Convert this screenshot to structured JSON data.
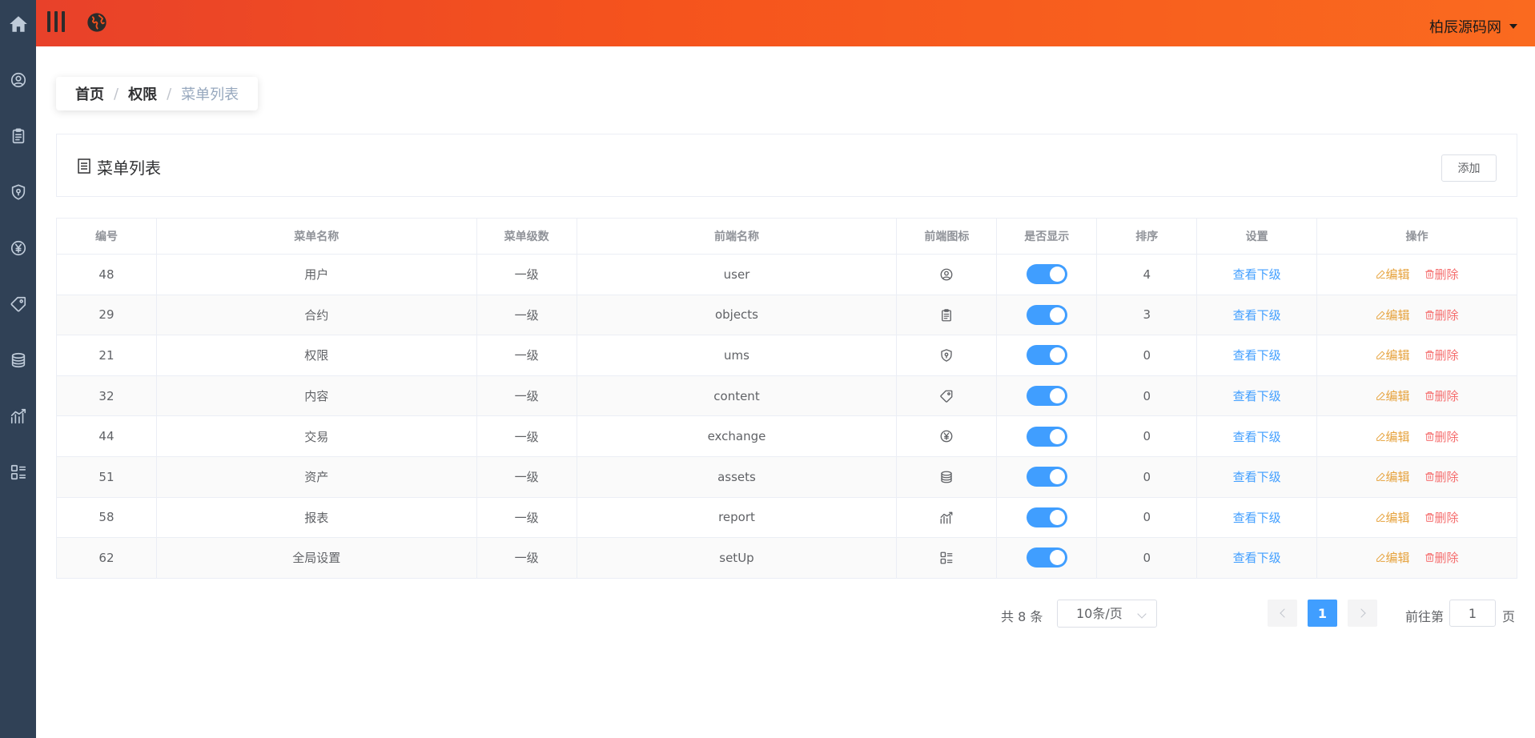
{
  "header": {
    "user_name": "柏辰源码网"
  },
  "sidebar": {
    "items": [
      {
        "icon": "home-icon"
      },
      {
        "icon": "user-icon"
      },
      {
        "icon": "clipboard-icon"
      },
      {
        "icon": "shield-icon"
      },
      {
        "icon": "yen-icon"
      },
      {
        "icon": "tag-icon"
      },
      {
        "icon": "coins-icon"
      },
      {
        "icon": "chart-icon"
      },
      {
        "icon": "list-grid-icon"
      }
    ]
  },
  "breadcrumb": {
    "home": "首页",
    "section": "权限",
    "separator": "/",
    "current": "菜单列表"
  },
  "panel": {
    "title": "菜单列表",
    "add_label": "添加"
  },
  "table": {
    "columns": [
      "编号",
      "菜单名称",
      "菜单级数",
      "前端名称",
      "前端图标",
      "是否显示",
      "排序",
      "设置",
      "操作"
    ],
    "rows": [
      {
        "id": "48",
        "name": "用户",
        "level": "一级",
        "frontend": "user",
        "icon": "user-icon",
        "shown": true,
        "sort": "4"
      },
      {
        "id": "29",
        "name": "合约",
        "level": "一级",
        "frontend": "objects",
        "icon": "clipboard-icon",
        "shown": true,
        "sort": "3"
      },
      {
        "id": "21",
        "name": "权限",
        "level": "一级",
        "frontend": "ums",
        "icon": "shield-icon",
        "shown": true,
        "sort": "0"
      },
      {
        "id": "32",
        "name": "内容",
        "level": "一级",
        "frontend": "content",
        "icon": "tag-icon",
        "shown": true,
        "sort": "0"
      },
      {
        "id": "44",
        "name": "交易",
        "level": "一级",
        "frontend": "exchange",
        "icon": "yen-icon",
        "shown": true,
        "sort": "0"
      },
      {
        "id": "51",
        "name": "资产",
        "level": "一级",
        "frontend": "assets",
        "icon": "coins-icon",
        "shown": true,
        "sort": "0"
      },
      {
        "id": "58",
        "name": "报表",
        "level": "一级",
        "frontend": "report",
        "icon": "chart-icon",
        "shown": true,
        "sort": "0"
      },
      {
        "id": "62",
        "name": "全局设置",
        "level": "一级",
        "frontend": "setUp",
        "icon": "list-grid-icon",
        "shown": true,
        "sort": "0"
      }
    ],
    "view_children_label": "查看下级",
    "edit_label": "编辑",
    "delete_label": "删除"
  },
  "pagination": {
    "total": "共 8 条",
    "page_size": "10条/页",
    "current_page": "1",
    "goto_prefix": "前往第",
    "goto_value": "1",
    "goto_suffix": "页"
  },
  "colors": {
    "header_gradient_start": "#e8412a",
    "header_gradient_end": "#fa6a1f",
    "sidebar_bg": "#304156",
    "primary": "#409eff",
    "warning": "#e6a23c",
    "danger": "#f56c6c"
  }
}
